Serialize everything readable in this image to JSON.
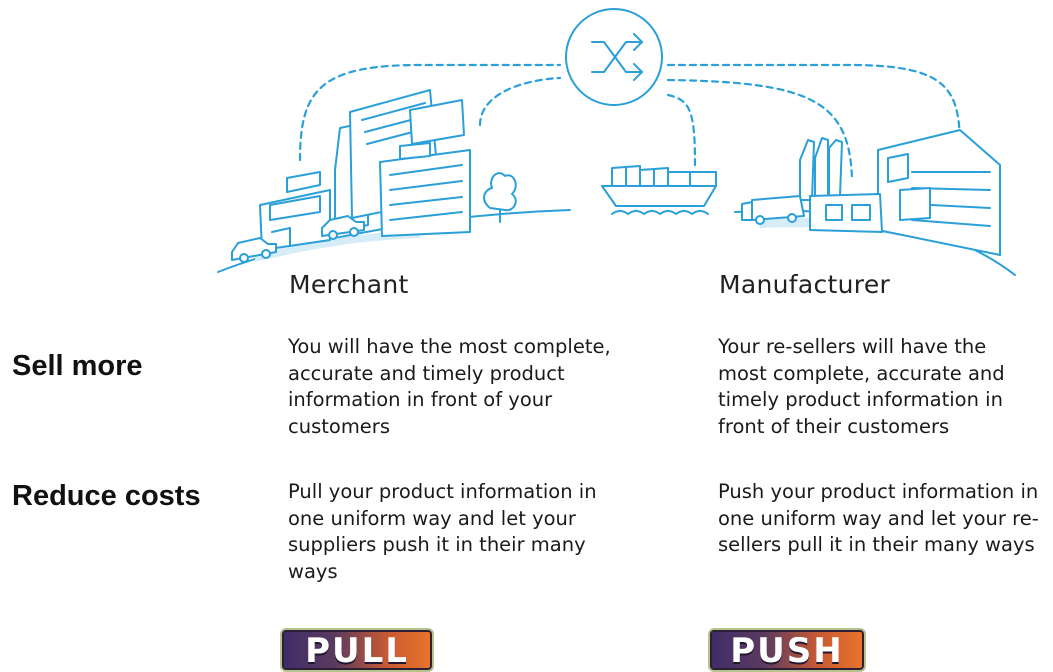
{
  "columns": {
    "merchant": {
      "heading": "Merchant",
      "sell_more": "You will have the most complete, accurate and timely product information in front of your customers",
      "reduce_costs": "Pull your product information in one uniform way and let your suppliers push it in their many ways",
      "badge": "PULL"
    },
    "manufacturer": {
      "heading": "Manufacturer",
      "sell_more": "Your re-sellers will have the most complete, accurate and timely product information in front of their customers",
      "reduce_costs": "Push your product information in one uniform way and let your re-sellers pull it in their many ways",
      "badge": "PUSH"
    }
  },
  "rows": {
    "sell_more": "Sell more",
    "reduce_costs": "Reduce costs"
  },
  "colors": {
    "illustration_line": "#2a9fd8",
    "badge_gradient": [
      "#3f2d6a",
      "#e8742a"
    ]
  },
  "icons": [
    "shuffle-hub-icon",
    "merchant-buildings-icon",
    "cargo-ship-icon",
    "factory-icon"
  ]
}
